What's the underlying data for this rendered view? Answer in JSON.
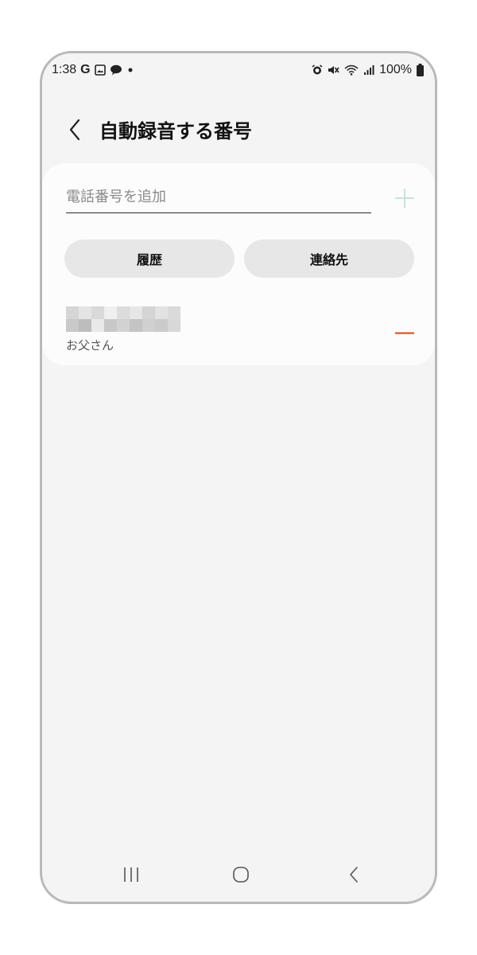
{
  "status_bar": {
    "time": "1:38",
    "g_label": "G",
    "battery": "100%",
    "icons": [
      "google-icon",
      "image-icon",
      "chat-bubble-icon",
      "notification-dot-icon",
      "alarm-icon",
      "mute-icon",
      "wifi-icon",
      "signal-icon",
      "battery-icon"
    ]
  },
  "header": {
    "title": "自動録音する番号",
    "back_icon": "chevron-left-icon"
  },
  "add_number": {
    "placeholder": "電話番号を追加",
    "value": "",
    "add_icon": "plus-icon"
  },
  "buttons": {
    "history_label": "履歴",
    "contacts_label": "連絡先"
  },
  "numbers": [
    {
      "number_redacted": true,
      "name": "お父さん",
      "remove_icon": "minus-icon"
    }
  ],
  "nav_bar": {
    "recents_icon": "recents-icon",
    "home_icon": "home-icon",
    "back_icon": "back-icon"
  },
  "colors": {
    "background": "#f4f4f4",
    "card": "#fcfcfc",
    "pill": "#e7e7e7",
    "add_accent": "#bde3cf",
    "remove_accent": "#e0522a",
    "frame": "#b9b9b9"
  }
}
